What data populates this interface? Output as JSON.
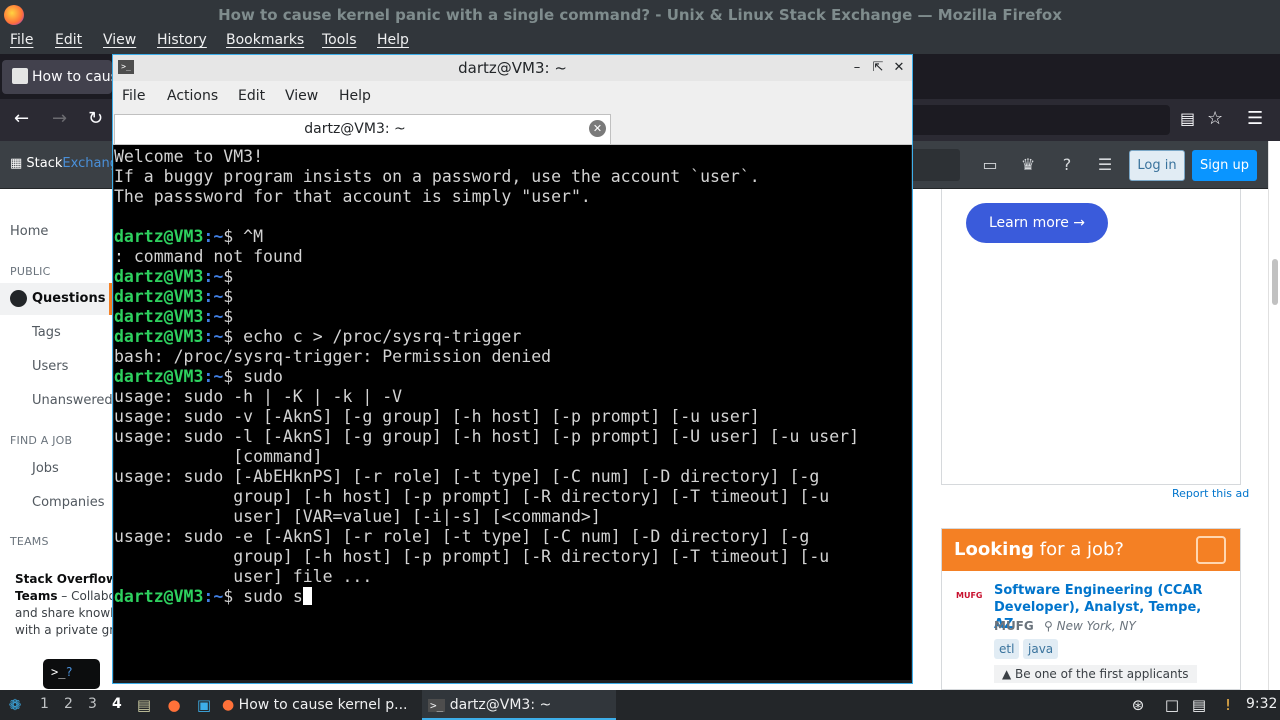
{
  "firefox": {
    "window_title": "How to cause kernel panic with a single command? - Unix & Linux Stack Exchange — Mozilla Firefox",
    "menu": [
      "File",
      "Edit",
      "View",
      "History",
      "Bookmarks",
      "Tools",
      "Help"
    ],
    "tab_title": "How to caus",
    "nav_icons": [
      "back-arrow-icon",
      "forward-arrow-icon",
      "reload-icon",
      "reader-view-icon",
      "bookmark-star-icon",
      "hamburger-menu-icon"
    ]
  },
  "stackexchange": {
    "logo_prefix": "Stack",
    "logo_suffix": "Exchang",
    "login_label": "Log in",
    "signup_label": "Sign up",
    "sidebar": {
      "home": "Home",
      "public_heading": "PUBLIC",
      "questions": "Questions",
      "tags": "Tags",
      "users": "Users",
      "unanswered": "Unanswered",
      "find_job_heading": "FIND A JOB",
      "jobs": "Jobs",
      "companies": "Companies",
      "teams_heading": "TEAMS",
      "teams_promo_title": "Stack Overflow",
      "teams_promo_bold": "Teams",
      "teams_promo_line1": " – Collabo",
      "teams_promo_line2": "and share knowl",
      "teams_promo_line3": "with a private gro",
      "teams_widget_prompt": ">_",
      "teams_widget_q": "?"
    },
    "ad": {
      "learn_more": "Learn more →",
      "report": "Report this ad"
    },
    "jobs_box": {
      "heading_bold": "Looking",
      "heading_rest": " for a job?",
      "company_logo_text": "MUFG",
      "title": "Software Engineering (CCAR Developer), Analyst, Tempe, AZ",
      "company": "MUFG",
      "location": "New York, NY",
      "tags": [
        "etl",
        "java"
      ],
      "applicants": "Be one of the first applicants"
    }
  },
  "terminal": {
    "window_title": "dartz@VM3: ~",
    "menu": [
      "File",
      "Actions",
      "Edit",
      "View",
      "Help"
    ],
    "tab_label": "dartz@VM3: ~",
    "prompt_user": "dartz@VM3",
    "prompt_path": ":~",
    "prompt_symbol": "$",
    "lines": [
      {
        "kind": "out",
        "text": "Welcome to VM3!"
      },
      {
        "kind": "out",
        "text": "If a buggy program insists on a password, use the account `user`."
      },
      {
        "kind": "out",
        "text": "The passsword for that account is simply \"user\"."
      },
      {
        "kind": "out",
        "text": ""
      },
      {
        "kind": "cmd",
        "text": " ^M"
      },
      {
        "kind": "out",
        "text": ": command not found"
      },
      {
        "kind": "cmd",
        "text": ""
      },
      {
        "kind": "cmd",
        "text": ""
      },
      {
        "kind": "cmd",
        "text": ""
      },
      {
        "kind": "cmd",
        "text": " echo c > /proc/sysrq-trigger"
      },
      {
        "kind": "out",
        "text": "bash: /proc/sysrq-trigger: Permission denied"
      },
      {
        "kind": "cmd",
        "text": " sudo"
      },
      {
        "kind": "out",
        "text": "usage: sudo -h | -K | -k | -V"
      },
      {
        "kind": "out",
        "text": "usage: sudo -v [-AknS] [-g group] [-h host] [-p prompt] [-u user]"
      },
      {
        "kind": "out",
        "text": "usage: sudo -l [-AknS] [-g group] [-h host] [-p prompt] [-U user] [-u user]"
      },
      {
        "kind": "out",
        "text": "            [command]"
      },
      {
        "kind": "out",
        "text": "usage: sudo [-AbEHknPS] [-r role] [-t type] [-C num] [-D directory] [-g"
      },
      {
        "kind": "out",
        "text": "            group] [-h host] [-p prompt] [-R directory] [-T timeout] [-u"
      },
      {
        "kind": "out",
        "text": "            user] [VAR=value] [-i|-s] [<command>]"
      },
      {
        "kind": "out",
        "text": "usage: sudo -e [-AknS] [-r role] [-t type] [-C num] [-D directory] [-g"
      },
      {
        "kind": "out",
        "text": "            group] [-h host] [-p prompt] [-R directory] [-T timeout] [-u"
      },
      {
        "kind": "out",
        "text": "            user] file ..."
      },
      {
        "kind": "cmd",
        "text": " sudo s",
        "cursor": true
      }
    ]
  },
  "taskbar": {
    "workspaces": [
      "1",
      "2",
      "3",
      "4"
    ],
    "active_workspace": "4",
    "tasks": [
      {
        "label": "How to cause kernel p...",
        "icon": "firefox-icon"
      },
      {
        "label": "dartz@VM3: ~",
        "icon": "terminal-icon"
      }
    ],
    "clock": "9:32"
  },
  "colors": {
    "prompt_user": "#2ed15f",
    "prompt_path": "#3f7de0",
    "accent": "#3daee9",
    "se_orange": "#f48024",
    "learn_more_bg": "#3a5bdb"
  }
}
